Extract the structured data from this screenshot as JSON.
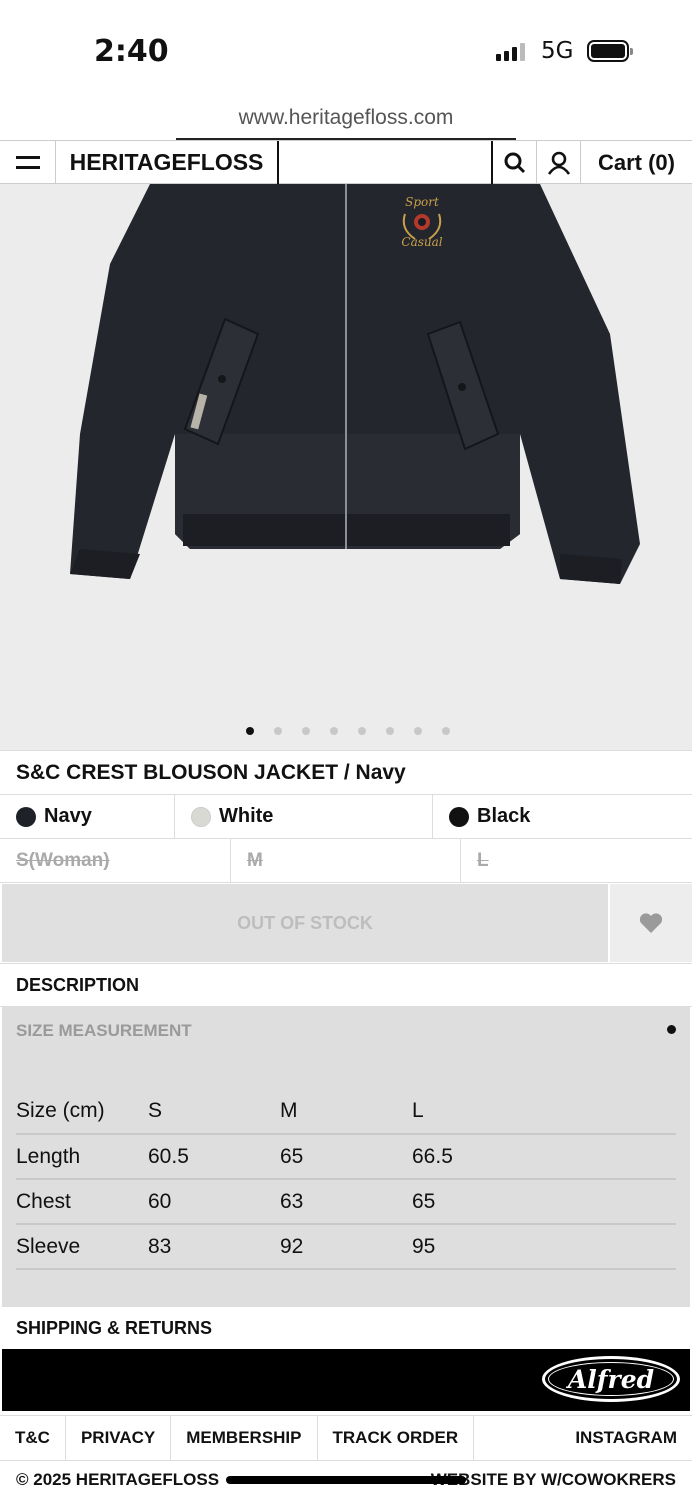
{
  "status": {
    "time": "2:40",
    "network": "5G"
  },
  "browser": {
    "url": "www.heritagefloss.com"
  },
  "header": {
    "brand": "HERITAGEFLOSS",
    "cart_label": "Cart (0)"
  },
  "gallery": {
    "image_count": 8,
    "active_index": 0,
    "crest_line1": "Sport",
    "crest_line2": "Casual"
  },
  "product": {
    "title": "S&C CREST BLOUSON JACKET / Navy",
    "colors": [
      {
        "name": "Navy",
        "swatch": "#1e2128"
      },
      {
        "name": "White",
        "swatch": "#d9d9d4"
      },
      {
        "name": "Black",
        "swatch": "#111111"
      }
    ],
    "sizes": [
      "S(Woman)",
      "M",
      "L"
    ],
    "stock_label": "OUT OF STOCK"
  },
  "sections": {
    "description": "DESCRIPTION",
    "size_measurement": "SIZE MEASUREMENT",
    "shipping": "SHIPPING & RETURNS"
  },
  "size_table": {
    "header": [
      "Size (cm)",
      "S",
      "M",
      "L"
    ],
    "rows": [
      [
        "Length",
        "60.5",
        "65",
        "66.5"
      ],
      [
        "Chest",
        "60",
        "63",
        "65"
      ],
      [
        "Sleeve",
        "83",
        "92",
        "95"
      ]
    ]
  },
  "banner": {
    "logo_text": "Alfred"
  },
  "footer": {
    "links": [
      "T&C",
      "PRIVACY",
      "MEMBERSHIP",
      "TRACK ORDER",
      "INSTAGRAM"
    ],
    "copyright": "© 2025 HERITAGEFLOSS",
    "credit": "WEBSITE BY W/COWOKRERS"
  }
}
